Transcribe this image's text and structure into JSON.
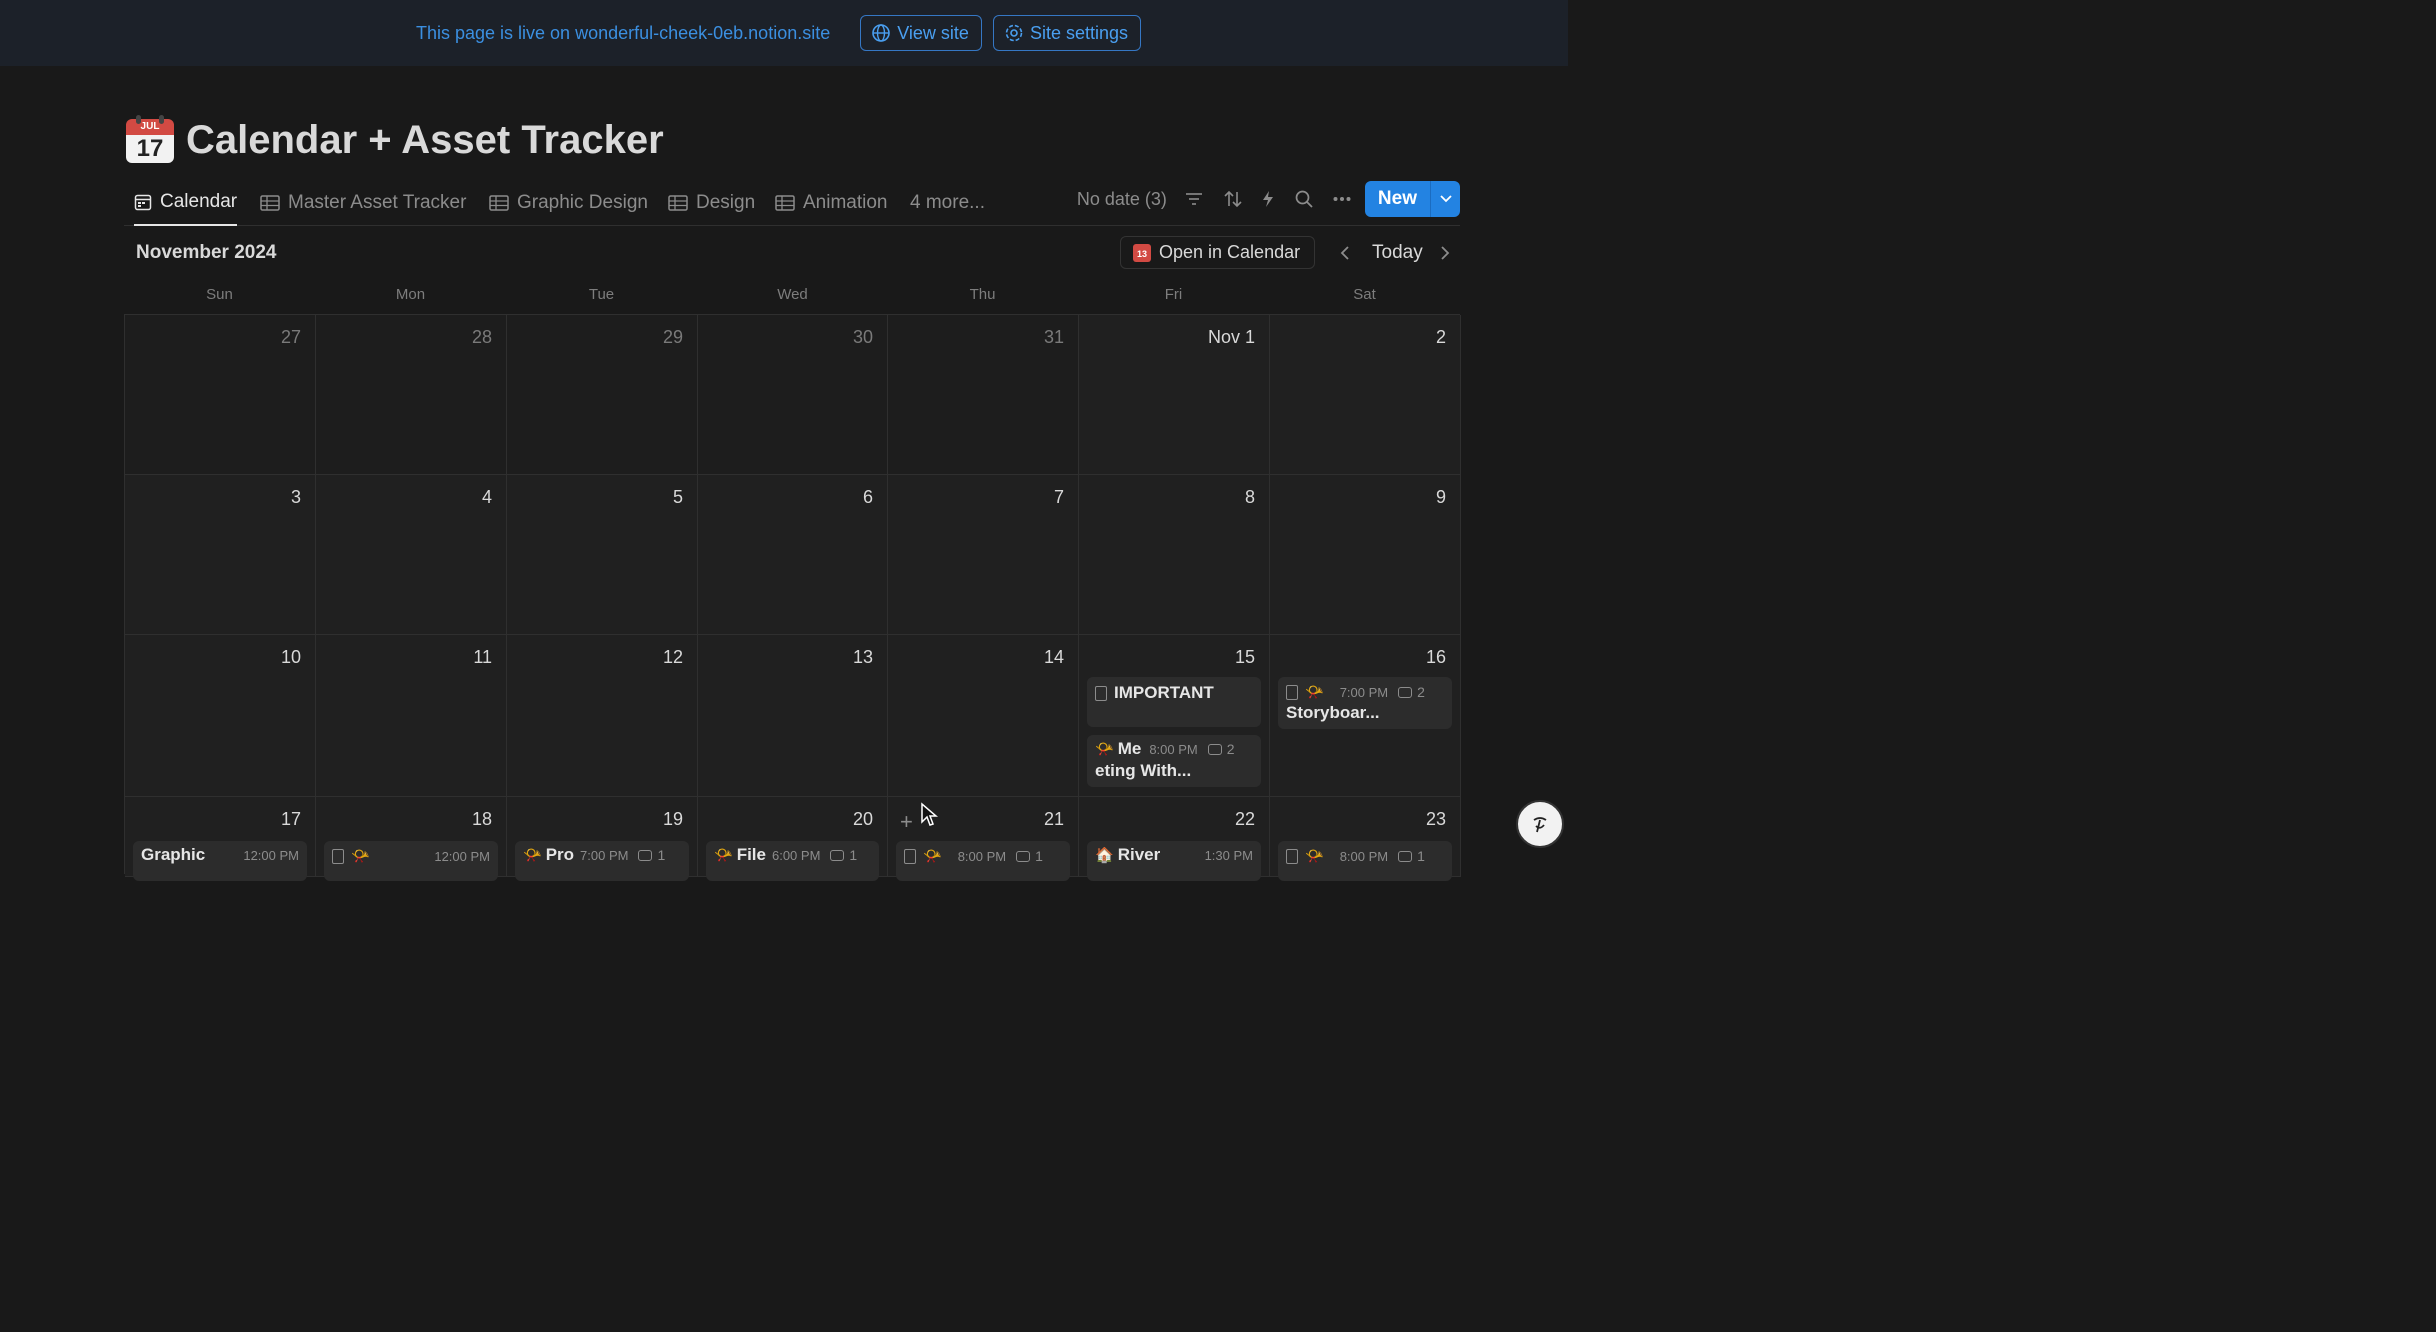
{
  "banner": {
    "text": "This page is live on wonderful-cheek-0eb.notion.site",
    "view_site": "View site",
    "site_settings": "Site settings"
  },
  "page": {
    "icon_month": "JUL",
    "icon_day": "17",
    "title": "Calendar + Asset Tracker"
  },
  "views": {
    "tabs": [
      {
        "label": "Calendar",
        "icon": "calendar-icon",
        "active": true
      },
      {
        "label": "Master Asset Tracker",
        "icon": "table-icon"
      },
      {
        "label": "Graphic Design",
        "icon": "table-icon"
      },
      {
        "label": "Design",
        "icon": "table-icon"
      },
      {
        "label": "Animation",
        "icon": "table-icon"
      }
    ],
    "more": "4 more...",
    "no_date": "No date (3)",
    "new_label": "New"
  },
  "calendar": {
    "month_label": "November 2024",
    "open_in_calendar": "Open in Calendar",
    "open_icon_day": "13",
    "today": "Today",
    "weekdays": [
      "Sun",
      "Mon",
      "Tue",
      "Wed",
      "Thu",
      "Fri",
      "Sat"
    ],
    "weeks": [
      [
        "27",
        "28",
        "29",
        "30",
        "31",
        "Nov 1",
        "2"
      ],
      [
        "3",
        "4",
        "5",
        "6",
        "7",
        "8",
        "9"
      ],
      [
        "10",
        "11",
        "12",
        "13",
        "14",
        "15",
        "16"
      ],
      [
        "17",
        "18",
        "19",
        "20",
        "21",
        "22",
        "23"
      ]
    ],
    "events": {
      "fri15_a": {
        "title": "IMPORTANT"
      },
      "fri15_b": {
        "title_start": "Me",
        "time": "8:00 PM",
        "comments": "2",
        "title_rest": "eting With..."
      },
      "sat16": {
        "time": "7:00 PM",
        "comments": "2",
        "title": "Storyboar..."
      },
      "sun17": {
        "title": "Graphic",
        "time": "12:00 PM"
      },
      "mon18": {
        "time": "12:00 PM"
      },
      "tue19": {
        "title": "Pro",
        "time": "7:00 PM",
        "comments": "1"
      },
      "wed20": {
        "title": "File",
        "time": "6:00 PM",
        "comments": "1"
      },
      "thu21": {
        "time": "8:00 PM",
        "comments": "1"
      },
      "fri22": {
        "title": "River",
        "time": "1:30 PM"
      },
      "sat23": {
        "time": "8:00 PM",
        "comments": "1"
      }
    }
  }
}
